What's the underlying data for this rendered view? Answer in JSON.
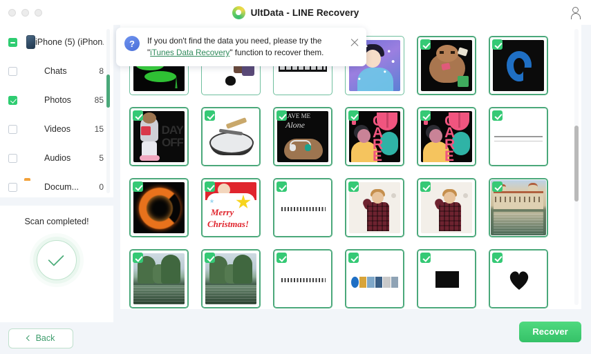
{
  "titlebar": {
    "app_title": "UltData - LINE Recovery",
    "logo_icon": "ultdata-logo-icon",
    "account_icon": "account-person-icon",
    "window_controls": [
      "close-dot",
      "minimize-dot",
      "maximize-dot"
    ]
  },
  "banner": {
    "question_mark": "?",
    "text_before": "If you don't find the data you need, please try the \"",
    "link_text": "iTunes Data Recovery",
    "text_after": "\" function to recover them.",
    "close_icon": "close-icon"
  },
  "sidebar": {
    "items": [
      {
        "label": "iPhone (5) (iPhon...",
        "count": "",
        "checkbox": "partial",
        "icon": "iphone-device-icon"
      },
      {
        "label": "Chats",
        "count": "8",
        "checkbox": "off",
        "icon": "chats-icon"
      },
      {
        "label": "Photos",
        "count": "85",
        "checkbox": "on",
        "icon": "photos-icon"
      },
      {
        "label": "Videos",
        "count": "15",
        "checkbox": "off",
        "icon": "videos-icon"
      },
      {
        "label": "Audios",
        "count": "5",
        "checkbox": "off",
        "icon": "audios-icon"
      },
      {
        "label": "Docum...",
        "count": "0",
        "checkbox": "off",
        "icon": "documents-folder-icon"
      }
    ],
    "scan_status": "Scan completed!",
    "scan_icon": "success-check-icon",
    "back_label": "Back",
    "back_icon": "chevron-left-icon"
  },
  "main": {
    "recover_label": "Recover",
    "scrollbar": "vertical-scrollbar",
    "thumbnails": [
      {
        "name": "thumb-lotus-night",
        "selected": false,
        "art": "art-lotus"
      },
      {
        "name": "thumb-cat-manga",
        "selected": false,
        "art": "art-cat"
      },
      {
        "name": "thumb-film-strip",
        "selected": false,
        "art": "art-film"
      },
      {
        "name": "thumb-lady-portrait",
        "selected": false,
        "art": "art-lady"
      },
      {
        "name": "thumb-sloth-sticker",
        "selected": true,
        "art": "art-sloth"
      },
      {
        "name": "thumb-blue-logo",
        "selected": true,
        "art": "art-logo-b"
      },
      {
        "name": "thumb-day-off",
        "selected": true,
        "art": "art-dayoff"
      },
      {
        "name": "thumb-ashtray",
        "selected": true,
        "art": "art-ash"
      },
      {
        "name": "thumb-leave-me-alone",
        "selected": true,
        "art": "art-alone"
      },
      {
        "name": "thumb-i-care-1",
        "selected": true,
        "art": "art-care"
      },
      {
        "name": "thumb-i-care-2",
        "selected": true,
        "art": "art-care"
      },
      {
        "name": "thumb-blank-lines",
        "selected": true,
        "art": "art-lines"
      },
      {
        "name": "thumb-fire-ring",
        "selected": true,
        "art": "art-fire"
      },
      {
        "name": "thumb-merry-christmas",
        "selected": true,
        "art": "art-xmas"
      },
      {
        "name": "thumb-jp-text-1",
        "selected": true,
        "art": "art-jp"
      },
      {
        "name": "thumb-man-plaid-1",
        "selected": true,
        "art": "art-man"
      },
      {
        "name": "thumb-man-plaid-2",
        "selected": true,
        "art": "art-man"
      },
      {
        "name": "thumb-castle-lake",
        "selected": true,
        "art": "art-castle"
      },
      {
        "name": "thumb-swamp-trees-1",
        "selected": true,
        "art": "art-swamp"
      },
      {
        "name": "thumb-swamp-trees-2",
        "selected": true,
        "art": "art-swamp"
      },
      {
        "name": "thumb-jp-text-2",
        "selected": true,
        "art": "art-jp"
      },
      {
        "name": "thumb-icon-strip",
        "selected": true,
        "art": "art-icons"
      },
      {
        "name": "thumb-black-box",
        "selected": true,
        "art": "art-blackbox"
      },
      {
        "name": "thumb-black-heart",
        "selected": true,
        "art": "art-heart"
      }
    ],
    "art_text": {
      "day_off_line1": "DAY",
      "day_off_line2": "OFF",
      "leave_me": "LEAVE ME",
      "alone": "Alone",
      "care_letters": "C\nA\nR\nE",
      "merry": "Merry",
      "christmas": "Christmas!"
    }
  },
  "colors": {
    "accent_green": "#35c268",
    "link_green": "#2f8a5b",
    "panel_bg": "#f2f5f9",
    "card_bg": "#ffffff",
    "cell_border": "#6fbf9e"
  }
}
